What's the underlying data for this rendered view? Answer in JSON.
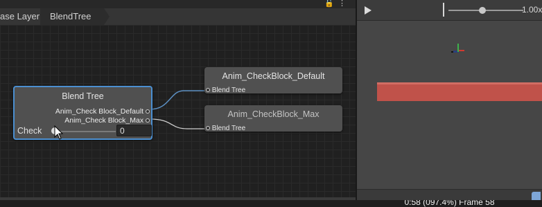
{
  "breadcrumb": {
    "items": [
      "Base Layer",
      "BlendTree"
    ],
    "visible_first": "ase Layer"
  },
  "toolbar_icons": [
    "lock-icon",
    "menu-icon"
  ],
  "blend_tree_node": {
    "title": "Blend Tree",
    "outputs": [
      "Anim_Check Block_Default",
      "Anim_Check Block_Max"
    ],
    "parameter": {
      "label": "Check",
      "value": "0",
      "slider_fraction": 0.0
    }
  },
  "clip_nodes": [
    {
      "title": "Anim_CheckBlock_Default",
      "input_label": "Blend Tree"
    },
    {
      "title": "Anim_CheckBlock_Max",
      "input_label": "Blend Tree"
    }
  ],
  "preview": {
    "speed_value": "1.00x",
    "speed_fraction": 0.4,
    "frame_status": "0:58 (097.4%) Frame 58"
  },
  "colors": {
    "selection_border": "#4b8fd1",
    "wire_active": "#5c8fc2",
    "wire_inactive": "#cfcfcf",
    "preview_object": "#c0524a"
  }
}
